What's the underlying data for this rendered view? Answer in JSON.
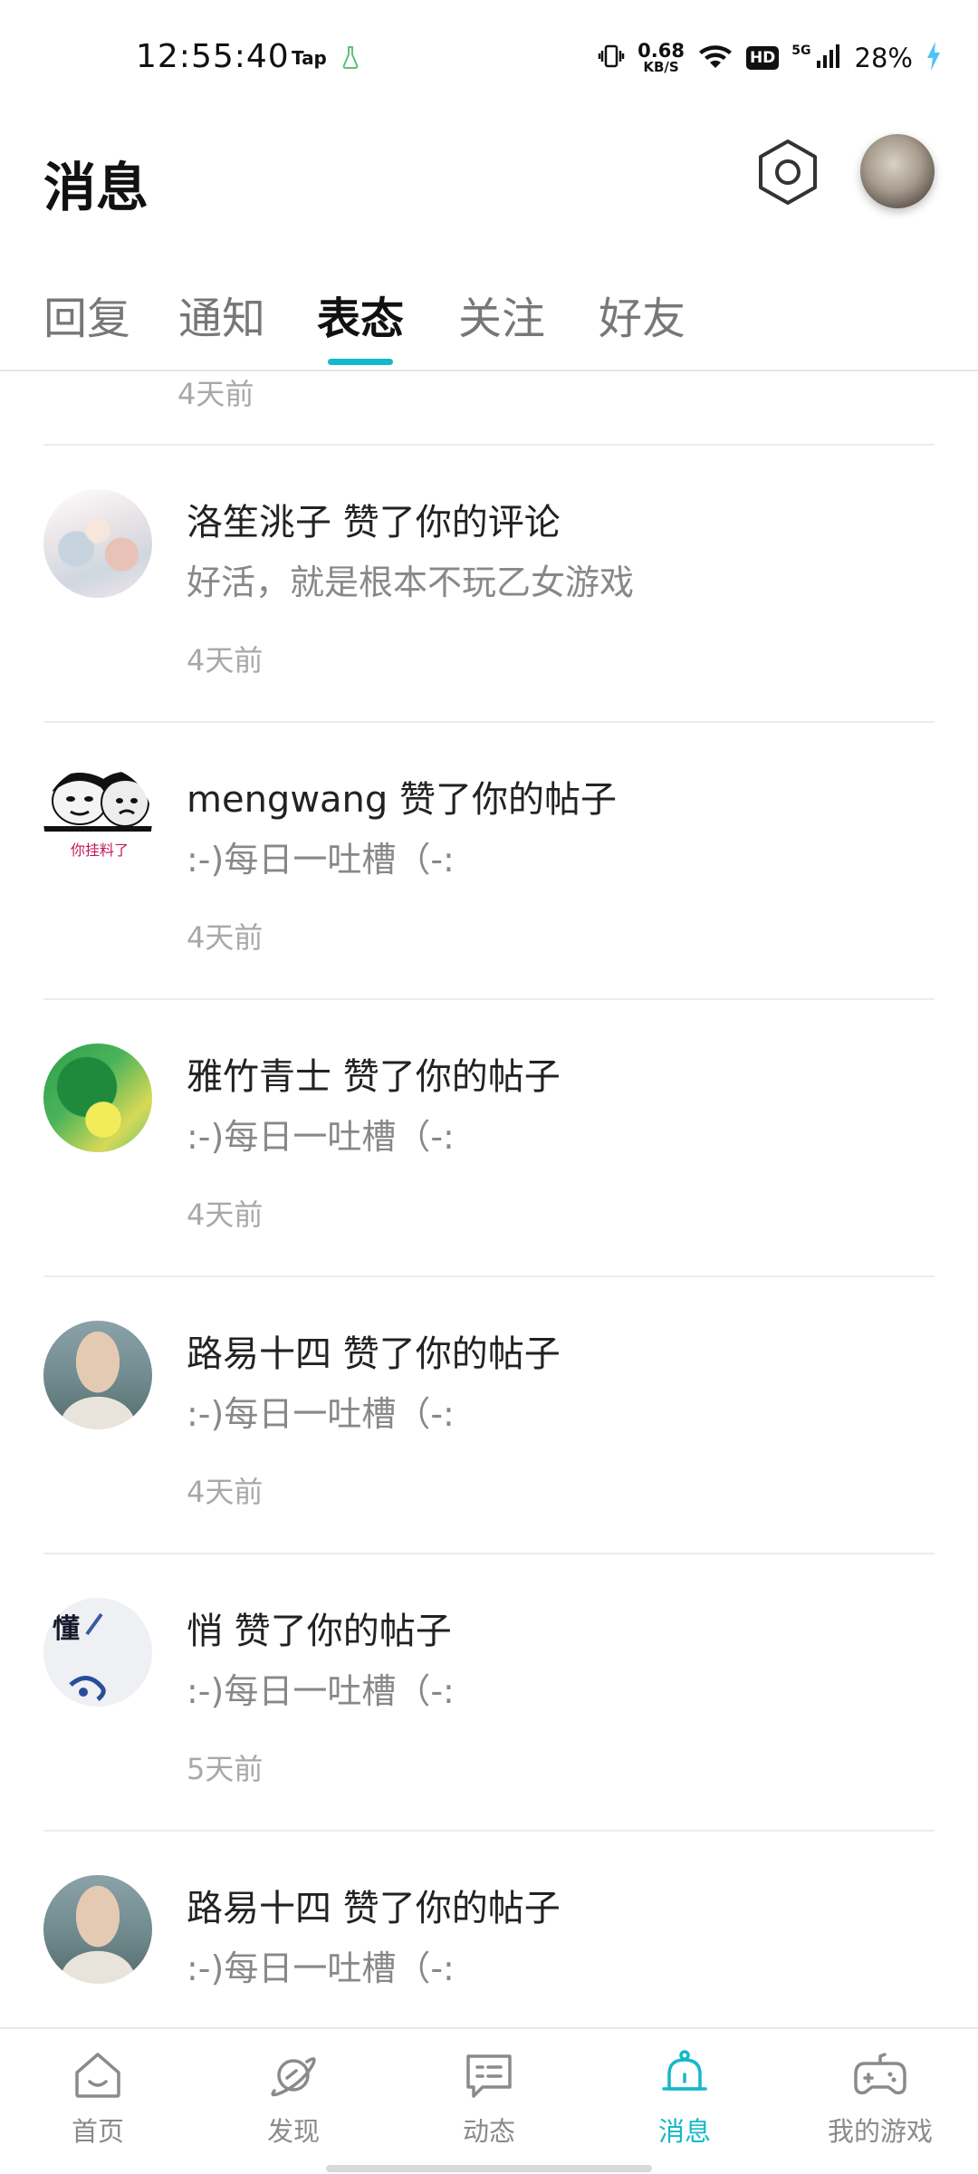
{
  "status_bar": {
    "time": "12:55:40",
    "app_tag": "Tap",
    "net_speed_value": "0.68",
    "net_speed_unit": "KB/S",
    "hd_label": "HD",
    "network_type": "5G",
    "battery_percent": "28%"
  },
  "header": {
    "title": "消息"
  },
  "tabs": [
    {
      "label": "回复"
    },
    {
      "label": "通知"
    },
    {
      "label": "表态"
    },
    {
      "label": "关注"
    },
    {
      "label": "好友"
    }
  ],
  "active_tab_index": 2,
  "partial_item": {
    "time": "4天前"
  },
  "notifications": [
    {
      "title": "洛笙洮子 赞了你的评论",
      "subtitle": "好活，就是根本不玩乙女游戏",
      "time": "4天前"
    },
    {
      "title": "mengwang 赞了你的帖子",
      "subtitle": ":-)每日一吐槽（-:",
      "time": "4天前",
      "avatar_caption": "你挂料了"
    },
    {
      "title": "雅竹青士 赞了你的帖子",
      "subtitle": ":-)每日一吐槽（-:",
      "time": "4天前"
    },
    {
      "title": "路易十四 赞了你的帖子",
      "subtitle": ":-)每日一吐槽（-:",
      "time": "4天前"
    },
    {
      "title": "悄 赞了你的帖子",
      "subtitle": ":-)每日一吐槽（-:",
      "time": "5天前",
      "avatar_caption": "懂"
    },
    {
      "title": "路易十四 赞了你的帖子",
      "subtitle": ":-)每日一吐槽（-:",
      "time": ""
    }
  ],
  "bottom_nav": [
    {
      "label": "首页",
      "icon": "home-icon"
    },
    {
      "label": "发现",
      "icon": "planet-icon"
    },
    {
      "label": "动态",
      "icon": "chat-bubble-icon"
    },
    {
      "label": "消息",
      "icon": "bell-icon"
    },
    {
      "label": "我的游戏",
      "icon": "gamepad-icon"
    }
  ],
  "active_nav_index": 3,
  "colors": {
    "accent": "#14b9c8",
    "text_primary": "#222222",
    "text_secondary": "#888888",
    "text_time": "#a8a8a8",
    "divider": "#ececec"
  }
}
